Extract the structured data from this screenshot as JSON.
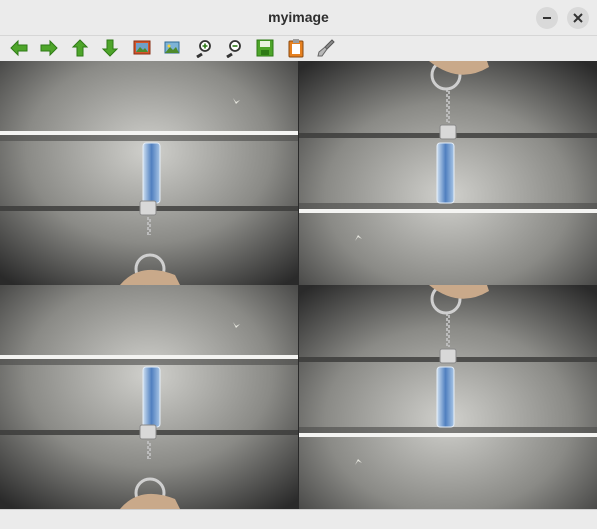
{
  "window": {
    "title": "myimage"
  },
  "toolbar": {
    "buttons": [
      {
        "name": "back-arrow-icon"
      },
      {
        "name": "forward-arrow-icon"
      },
      {
        "name": "up-arrow-icon"
      },
      {
        "name": "down-arrow-icon"
      },
      {
        "name": "image-icon"
      },
      {
        "name": "fit-image-icon"
      },
      {
        "name": "zoom-in-icon"
      },
      {
        "name": "zoom-out-icon"
      },
      {
        "name": "save-icon"
      },
      {
        "name": "clipboard-icon"
      },
      {
        "name": "brush-icon"
      }
    ]
  },
  "colors": {
    "arrow_green": "#4ea52a",
    "titlebar": "#ebebeb",
    "close_button": "#d9d9d9"
  }
}
